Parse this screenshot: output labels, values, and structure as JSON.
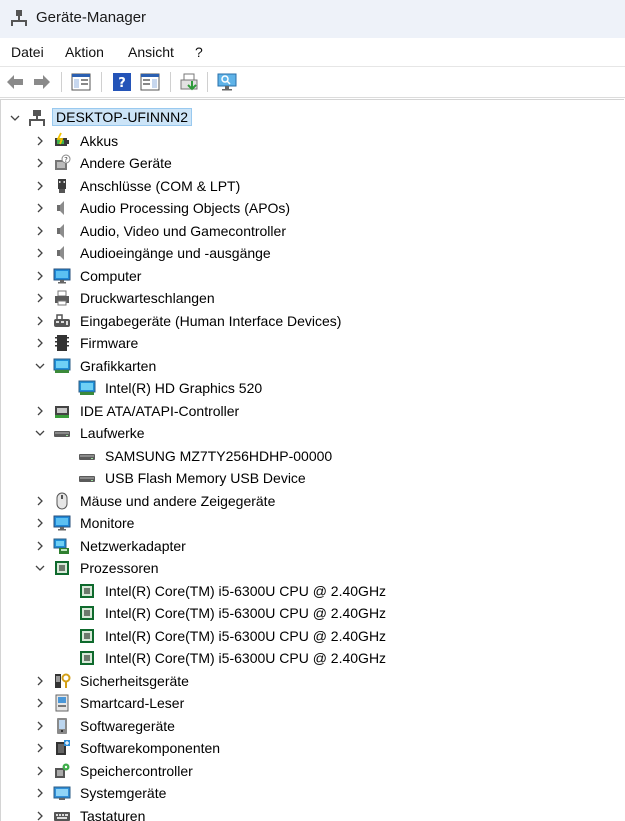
{
  "window": {
    "title": "Geräte-Manager"
  },
  "menu": {
    "file": "Datei",
    "action": "Aktion",
    "view": "Ansicht",
    "help": "?"
  },
  "tree": {
    "root": "DESKTOP-UFINNN2",
    "items": [
      {
        "label": "Akkus",
        "icon": "battery-icon"
      },
      {
        "label": "Andere Geräte",
        "icon": "unknown-device-icon"
      },
      {
        "label": "Anschlüsse (COM & LPT)",
        "icon": "port-icon"
      },
      {
        "label": "Audio Processing Objects (APOs)",
        "icon": "speaker-icon"
      },
      {
        "label": "Audio, Video und Gamecontroller",
        "icon": "speaker-icon"
      },
      {
        "label": "Audioeingänge und -ausgänge",
        "icon": "speaker-icon"
      },
      {
        "label": "Computer",
        "icon": "monitor-icon"
      },
      {
        "label": "Druckwarteschlangen",
        "icon": "printer-icon"
      },
      {
        "label": "Eingabegeräte (Human Interface Devices)",
        "icon": "hid-icon"
      },
      {
        "label": "Firmware",
        "icon": "firmware-icon"
      },
      {
        "label": "Grafikkarten",
        "icon": "display-adapter-icon",
        "expanded": true,
        "children": [
          {
            "label": "Intel(R) HD Graphics 520",
            "icon": "display-adapter-icon"
          }
        ]
      },
      {
        "label": "IDE ATA/ATAPI-Controller",
        "icon": "ide-controller-icon"
      },
      {
        "label": "Laufwerke",
        "icon": "drive-icon",
        "expanded": true,
        "children": [
          {
            "label": "SAMSUNG MZ7TY256HDHP-00000",
            "icon": "drive-icon"
          },
          {
            "label": "USB Flash Memory USB Device",
            "icon": "drive-icon"
          }
        ]
      },
      {
        "label": "Mäuse und andere Zeigegeräte",
        "icon": "mouse-icon"
      },
      {
        "label": "Monitore",
        "icon": "monitor-icon"
      },
      {
        "label": "Netzwerkadapter",
        "icon": "network-adapter-icon"
      },
      {
        "label": "Prozessoren",
        "icon": "processor-icon",
        "expanded": true,
        "children": [
          {
            "label": "Intel(R) Core(TM) i5-6300U CPU @ 2.40GHz",
            "icon": "processor-icon"
          },
          {
            "label": "Intel(R) Core(TM) i5-6300U CPU @ 2.40GHz",
            "icon": "processor-icon"
          },
          {
            "label": "Intel(R) Core(TM) i5-6300U CPU @ 2.40GHz",
            "icon": "processor-icon"
          },
          {
            "label": "Intel(R) Core(TM) i5-6300U CPU @ 2.40GHz",
            "icon": "processor-icon"
          }
        ]
      },
      {
        "label": "Sicherheitsgeräte",
        "icon": "security-key-icon"
      },
      {
        "label": "Smartcard-Leser",
        "icon": "smartcard-reader-icon"
      },
      {
        "label": "Softwaregeräte",
        "icon": "software-device-icon"
      },
      {
        "label": "Softwarekomponenten",
        "icon": "software-component-icon"
      },
      {
        "label": "Speichercontroller",
        "icon": "storage-controller-icon"
      },
      {
        "label": "Systemgeräte",
        "icon": "system-device-icon"
      },
      {
        "label": "Tastaturen",
        "icon": "keyboard-icon"
      }
    ]
  }
}
